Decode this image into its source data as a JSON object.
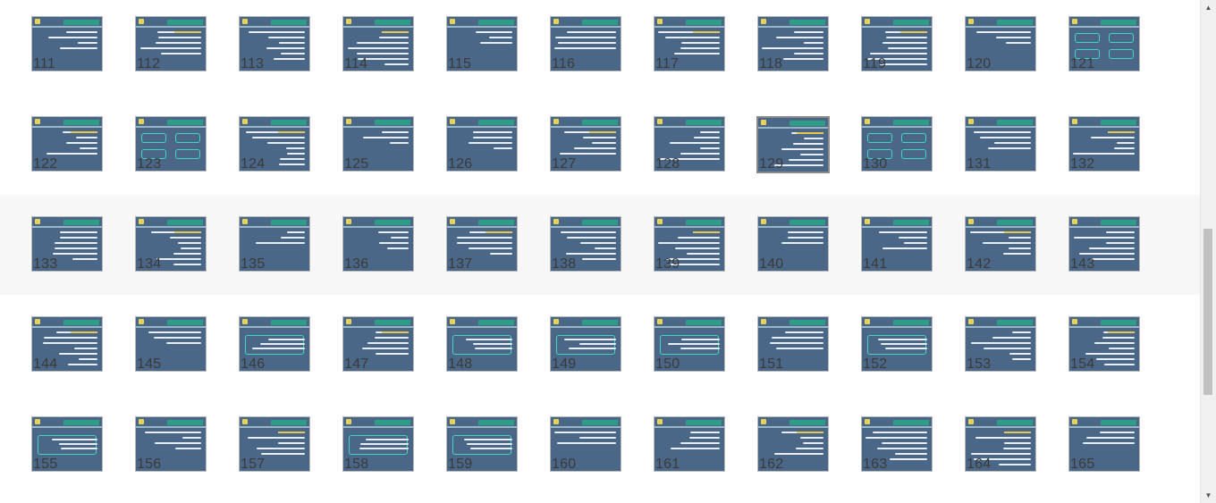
{
  "slides": [
    [
      "111",
      "112",
      "113",
      "114",
      "115",
      "116",
      "117",
      "118",
      "119",
      "120",
      "121"
    ],
    [
      "122",
      "123",
      "124",
      "125",
      "126",
      "127",
      "128",
      "129",
      "130",
      "131",
      "132"
    ],
    [
      "133",
      "134",
      "135",
      "136",
      "137",
      "138",
      "139",
      "140",
      "141",
      "142",
      "143"
    ],
    [
      "144",
      "145",
      "146",
      "147",
      "148",
      "149",
      "150",
      "151",
      "152",
      "153",
      "154"
    ],
    [
      "155",
      "156",
      "157",
      "158",
      "159",
      "160",
      "161",
      "162",
      "163",
      "164",
      "165"
    ]
  ],
  "selected_slide": "129",
  "scrollbar": {
    "up_icon": "▲",
    "down_icon": "▼"
  },
  "colors": {
    "slide_background": "#4b6787",
    "slide_title_bar": "#2e9d88",
    "slide_accent": "#e8d25a",
    "page_background": "#ffffff"
  }
}
